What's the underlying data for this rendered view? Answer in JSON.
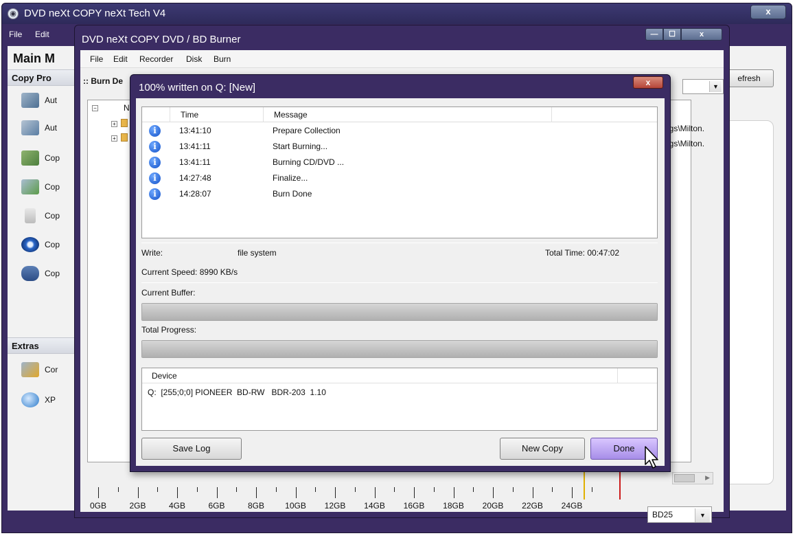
{
  "main_window": {
    "title": "DVD neXt COPY neXt Tech V4",
    "close_label": "x",
    "menu": [
      "File",
      "Edit"
    ],
    "sidebar_title": "Main M",
    "sections": [
      "Copy Pro",
      "Extras"
    ],
    "items": [
      "Aut",
      "Aut",
      "Cop",
      "Cop",
      "Cop",
      "Cop",
      "Cop",
      "Cor",
      "XP"
    ],
    "refresh_label": "efresh"
  },
  "burner_window": {
    "title": "DVD neXt COPY DVD / BD Burner",
    "controls": {
      "minimize": "—",
      "maximize": "☐",
      "close": "x"
    },
    "menu": [
      "File",
      "Edit",
      "Recorder",
      "Disk",
      "Burn"
    ],
    "burn_label": ":: Burn De",
    "tree": {
      "root": "N",
      "paths": [
        "ngs\\Milton.",
        "ngs\\Milton."
      ]
    },
    "ruler": {
      "labels": [
        "0GB",
        "2GB",
        "4GB",
        "6GB",
        "8GB",
        "10GB",
        "12GB",
        "14GB",
        "16GB",
        "18GB",
        "20GB",
        "22GB",
        "24GB"
      ],
      "markers": [
        {
          "color": "#e0b000"
        },
        {
          "color": "#cc1c1c"
        }
      ]
    },
    "disc_type": "BD25"
  },
  "dialog": {
    "title": "100% written on Q: [New]",
    "close_label": "x",
    "log_headers": {
      "time": "Time",
      "message": "Message"
    },
    "log": [
      {
        "time": "13:41:10",
        "message": "Prepare Collection"
      },
      {
        "time": "13:41:11",
        "message": "Start Burning..."
      },
      {
        "time": "13:41:11",
        "message": "Burning CD/DVD ..."
      },
      {
        "time": "14:27:48",
        "message": "Finalize..."
      },
      {
        "time": "14:28:07",
        "message": "Burn Done"
      }
    ],
    "write_label": "Write:",
    "write_value": "file system",
    "total_time": "Total Time: 00:47:02",
    "current_speed": "Current Speed: 8990 KB/s",
    "buffer_label": "Current Buffer:",
    "buffer_fraction": 1.0,
    "progress_label": "Total Progress:",
    "progress_fraction": 1.0,
    "device_header": "Device",
    "device": "Q:  [255;0;0] PIONEER  BD-RW   BDR-203  1.10",
    "buttons": {
      "save_log": "Save Log",
      "new_copy": "New Copy",
      "done": "Done"
    }
  }
}
